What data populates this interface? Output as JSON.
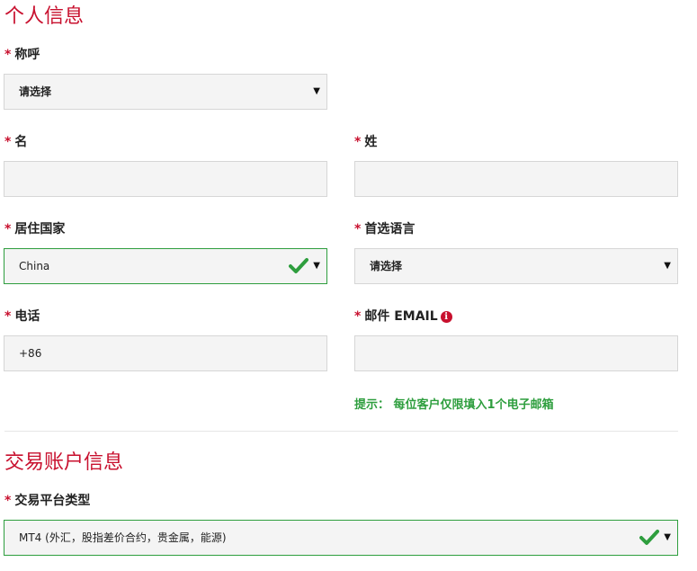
{
  "personal_info": {
    "title": "个人信息",
    "fields": {
      "salutation": {
        "label": "称呼",
        "value": "请选择"
      },
      "first_name": {
        "label": "名",
        "value": ""
      },
      "last_name": {
        "label": "姓",
        "value": ""
      },
      "country": {
        "label": "居住国家",
        "value": "China",
        "status": "valid"
      },
      "language": {
        "label": "首选语言",
        "value": "请选择"
      },
      "phone": {
        "label": "电话",
        "value": "+86"
      },
      "email": {
        "label": "邮件 EMAIL",
        "value": "",
        "info_icon": "i"
      }
    },
    "required_marker": "*",
    "email_hint": "提示： 每位客户仅限填入1个电子邮箱"
  },
  "trading_account": {
    "title": "交易账户信息",
    "fields": {
      "platform": {
        "label": "交易平台类型",
        "value": "MT4 (外汇，股指差价合约，贵金属，能源)",
        "status": "valid"
      }
    }
  },
  "icons": {
    "dropdown": "caret-down-icon",
    "valid": "checkmark-icon",
    "info": "info-circle-icon"
  },
  "colors": {
    "accent_red": "#c8102e",
    "valid_green": "#2e9e3e",
    "field_bg": "#f4f4f4",
    "field_border": "#d6d6d6"
  }
}
